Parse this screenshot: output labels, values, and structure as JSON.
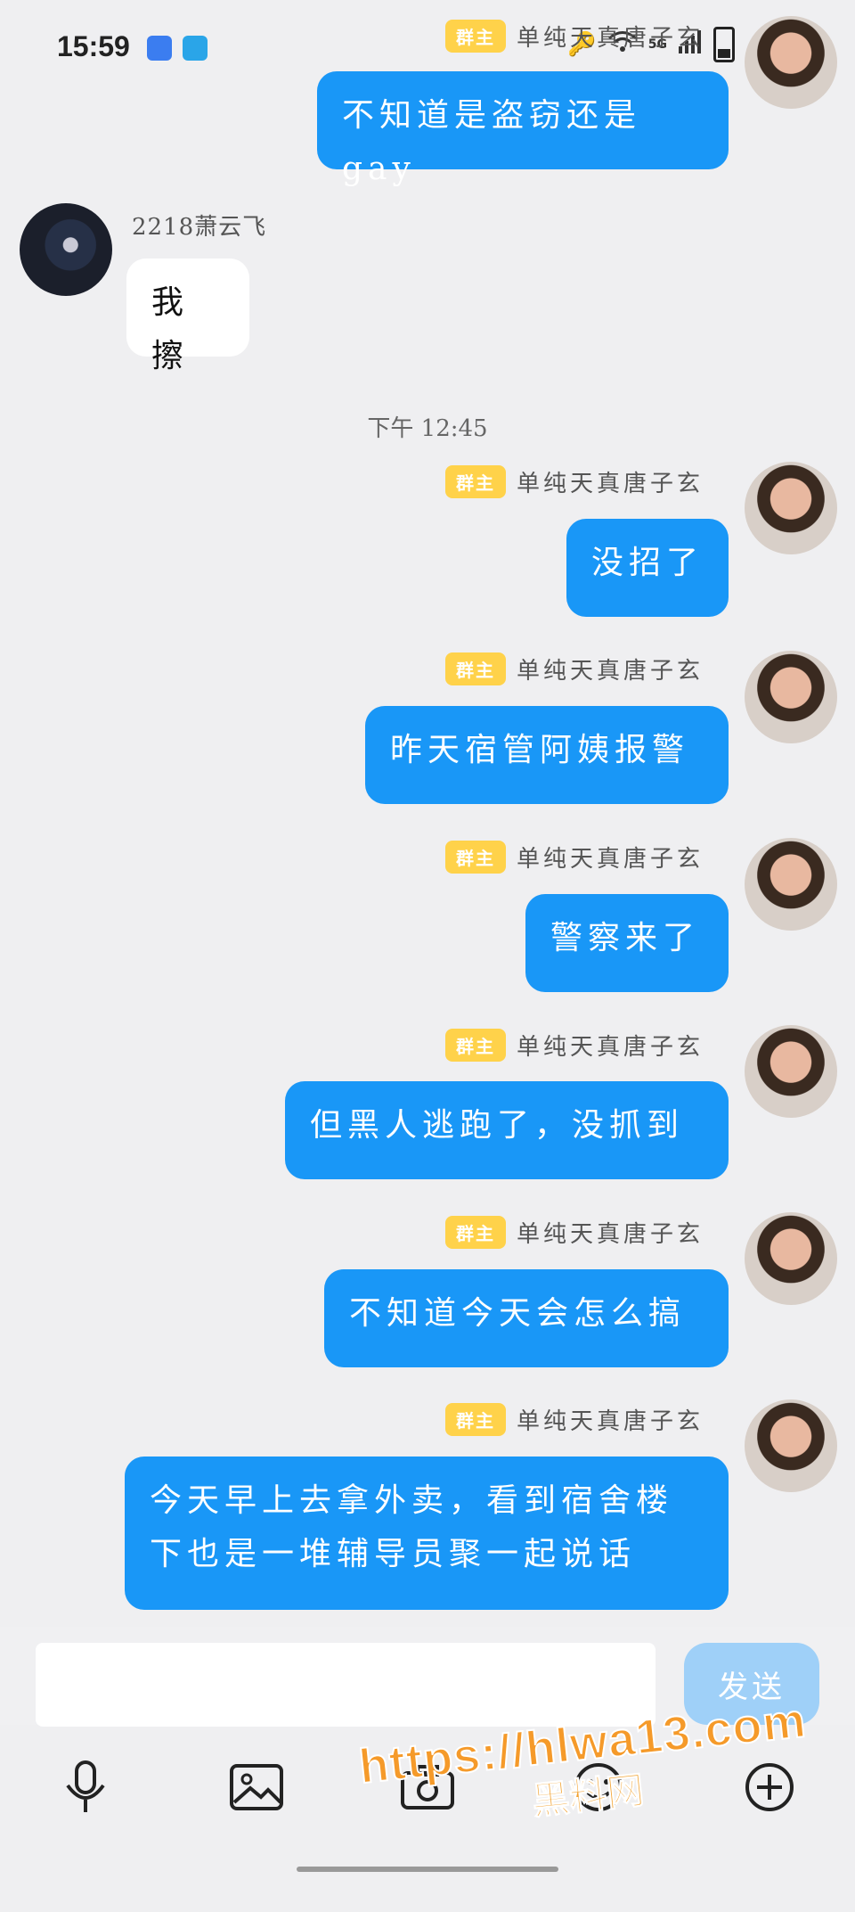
{
  "status_bar": {
    "time": "15:59",
    "network": "5G"
  },
  "chat": {
    "badge": "群主",
    "self_name": "单纯天真唐子玄",
    "other_name": "2218萧云飞",
    "time_separator": "下午 12:45",
    "messages": [
      {
        "text": "不知道是盗窃还是gay"
      },
      {
        "text": "我擦"
      },
      {
        "text": "没招了"
      },
      {
        "text": "昨天宿管阿姨报警"
      },
      {
        "text": "警察来了"
      },
      {
        "text": "但黑人逃跑了，没抓到"
      },
      {
        "text": "不知道今天会怎么搞"
      },
      {
        "text": "今天早上去拿外卖，看到宿舍楼下也是一堆辅导员聚一起说话"
      }
    ]
  },
  "composer": {
    "send_label": "发送"
  },
  "toolbar": {
    "icons": [
      "microphone-icon",
      "image-icon",
      "camera-icon",
      "emoji-icon",
      "plus-icon"
    ]
  },
  "watermark": {
    "url": "https://hlwa13.com",
    "site": "黑料网"
  }
}
